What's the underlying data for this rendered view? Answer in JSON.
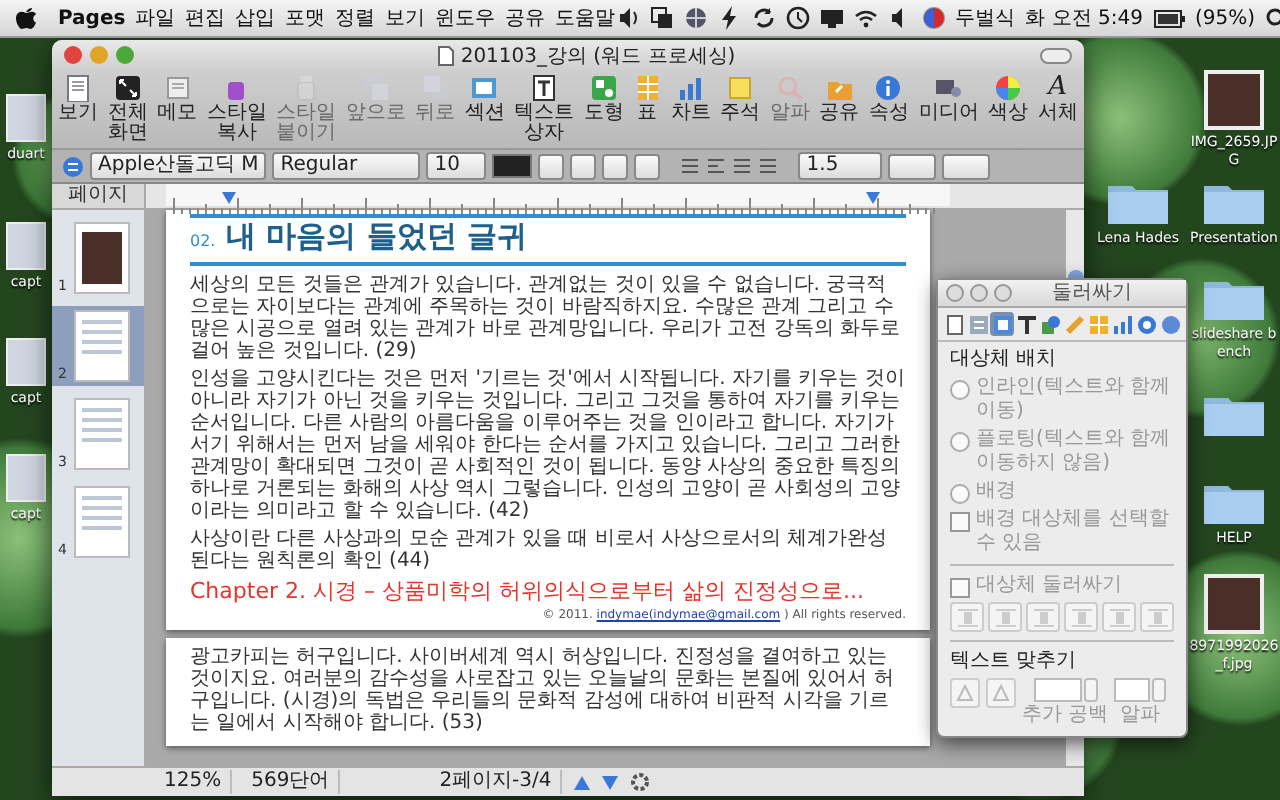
{
  "menu_bar": {
    "app": "Pages",
    "items": [
      "파일",
      "편집",
      "삽입",
      "포맷",
      "정렬",
      "보기",
      "윈도우",
      "공유",
      "도움말"
    ],
    "input_method": "두벌식",
    "clock": "화 오전 5:49",
    "battery": "(95%)"
  },
  "desktop": {
    "left_icons": [
      {
        "label": "duart"
      },
      {
        "label": "capt"
      },
      {
        "label": "capt"
      },
      {
        "label": "capt"
      }
    ],
    "icons": [
      {
        "label": "IMG_2659.JPG",
        "kind": "photo"
      },
      {
        "label": "Lena Hades",
        "kind": "folder"
      },
      {
        "label": "Presentation",
        "kind": "folder"
      },
      {
        "label": "slideshare bench",
        "kind": "folder"
      },
      {
        "kind": "folder"
      },
      {
        "label": "HELP",
        "kind": "folder"
      },
      {
        "label": "8971992026_f.jpg",
        "kind": "photo"
      }
    ]
  },
  "window": {
    "title": "201103_강의 (워드 프로세싱)",
    "toolbar": [
      {
        "label": "보기",
        "disabled": false
      },
      {
        "label": "전체 화면",
        "disabled": false
      },
      {
        "label": "메모",
        "disabled": false
      },
      {
        "label": "스타일 복사",
        "disabled": false
      },
      {
        "label": "스타일 붙이기",
        "disabled": true
      },
      {
        "label": "앞으로",
        "disabled": true
      },
      {
        "label": "뒤로",
        "disabled": true
      },
      {
        "label": "섹션",
        "disabled": false
      },
      {
        "label": "텍스트 상자",
        "disabled": false
      },
      {
        "label": "도형",
        "disabled": false
      },
      {
        "label": "표",
        "disabled": false
      },
      {
        "label": "차트",
        "disabled": false
      },
      {
        "label": "주석",
        "disabled": false
      },
      {
        "label": "알파",
        "disabled": true
      },
      {
        "label": "공유",
        "disabled": false
      },
      {
        "label": "속성",
        "disabled": false
      },
      {
        "label": "미디어",
        "disabled": false
      },
      {
        "label": "색상",
        "disabled": false
      },
      {
        "label": "서체",
        "disabled": false,
        "glyph": "A"
      }
    ],
    "format_bar": {
      "font": "Apple산돌고딕 M",
      "typeface": "Regular",
      "size": "10",
      "line_spacing": "1.5"
    },
    "sidebar": {
      "header": "페이지",
      "pages": [
        {
          "number": "1",
          "kind": "photo",
          "selected": false
        },
        {
          "number": "2",
          "kind": "text",
          "selected": true
        },
        {
          "number": "3",
          "kind": "text",
          "selected": false
        },
        {
          "number": "4",
          "kind": "text",
          "selected": false
        }
      ]
    },
    "document": {
      "pages": [
        {
          "number_prefix": "02.",
          "title": "내 마음의 들었던 글귀",
          "paragraphs": [
            "세상의 모든 것들은 관계가 있습니다. 관계없는 것이 있을 수 없습니다. 궁극적으로는 자이보다는 관계에 주목하는 것이 바람직하지요. 수많은 관계 그리고 수많은 시공으로 열려 있는 관계가 바로 관계망입니다. 우리가 고전 강독의 화두로 걸어 높은 것입니다. (29)",
            "인성을 고양시킨다는 것은 먼저 '기르는 것'에서 시작됩니다. 자기를 키우는 것이 아니라 자기가 아닌 것을 키우는 것입니다. 그리고 그것을 통하여 자기를 키우는 순서입니다. 다른 사람의 아름다움을 이루어주는 것을 인이라고 합니다. 자기가 서기 위해서는 먼저 남을 세워야 한다는 순서를 가지고 있습니다. 그리고 그러한 관계망이 확대되면 그것이 곧 사회적인 것이 됩니다. 동양 사상의 중요한 특징의 하나로 거론되는 화해의 사상 역시 그렇습니다. 인성의 고양이 곧 사회성의 고양이라는 의미라고 할 수 있습니다. (42)",
            "사상이란 다른 사상과의 모순 관계가 있을 때 비로서 사상으로서의 체계가완성된다는 원칙론의 확인 (44)"
          ],
          "chapter": "Chapter 2. 시경 – 상품미학의 허위의식으로부터 삶의 진정성으로...",
          "footer": {
            "before": "© 2011. ",
            "link": "indymae(indymae@gmail.com",
            "after": " ) All rights reserved."
          }
        },
        {
          "paragraphs": [
            "광고카피는 허구입니다. 사이버세계 역시 허상입니다. 진정성을 결여하고 있는 것이지요. 여러분의 감수성을 사로잡고 있는 오늘날의 문화는 본질에 있어서 허구입니다. (시경)의 독법은 우리들의 문화적 감성에 대하여 비판적 시각을 기르는 일에서 시작해야 합니다. (53)"
          ]
        }
      ]
    },
    "status_bar": {
      "zoom": "125%",
      "word_count": "569단어",
      "page": "2페이지-3/4"
    }
  },
  "inspector": {
    "title": "둘러싸기",
    "disabled": true,
    "tabs": [
      {
        "selected": false
      },
      {
        "selected": false
      },
      {
        "selected": true
      },
      {
        "selected": false
      },
      {
        "selected": false
      },
      {
        "selected": false
      },
      {
        "selected": false
      },
      {
        "selected": false
      },
      {
        "selected": false
      },
      {
        "selected": false
      }
    ],
    "section": "대상체 배치",
    "placement": [
      {
        "label": "인라인(텍스트와 함께 이동)",
        "selected": false
      },
      {
        "label": "플로팅(텍스트와 함께 이동하지 않음)",
        "selected": false
      },
      {
        "label": "배경",
        "selected": false
      }
    ],
    "background_selectable": {
      "label": "배경 대상체를 선택할 수 있음",
      "checked": false
    },
    "wrap": {
      "label": "대상체 둘러싸기",
      "checked": false
    },
    "text_fit": "텍스트 맞추기",
    "spacing_label": "추가 공백",
    "alpha_label": "알파"
  }
}
